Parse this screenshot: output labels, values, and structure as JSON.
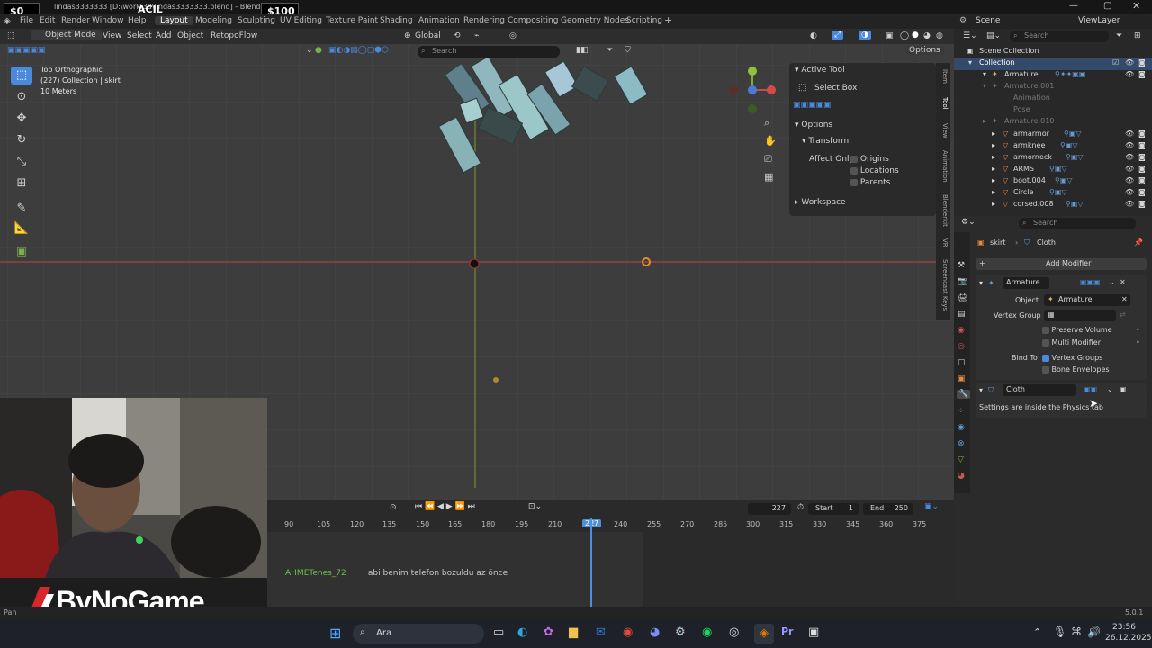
{
  "overlay": {
    "left_money": "$0",
    "tag": "ACIL",
    "right_money": "$100"
  },
  "window": {
    "title": "lindas3333333 [D:\\work\\3d\\lindas3333333.blend] - Blender 5.0.1"
  },
  "menu": [
    "File",
    "Edit",
    "Render",
    "Window",
    "Help"
  ],
  "workspaces": [
    "Layout",
    "Modeling",
    "Sculpting",
    "UV Editing",
    "Texture Paint",
    "Shading",
    "Animation",
    "Rendering",
    "Compositing",
    "Geometry Nodes",
    "Scripting"
  ],
  "scene": {
    "scene_label": "Scene",
    "viewlayer_label": "ViewLayer"
  },
  "viewport_header": {
    "mode": "Object Mode",
    "menus": [
      "View",
      "Select",
      "Add",
      "Object",
      "RetopoFlow"
    ],
    "transform": "Global",
    "options": "Options",
    "search_placeholder": "Search"
  },
  "viewport_info": {
    "view": "Top Orthographic",
    "collection": "(227) Collection | skirt",
    "scale": "10 Meters"
  },
  "npanel": {
    "active_tool_title": "Active Tool",
    "tool_name": "Select Box",
    "options_title": "Options",
    "transform_title": "Transform",
    "affect_only": "Affect Only",
    "origins": "Origins",
    "locations": "Locations",
    "parents": "Parents",
    "workspace": "Workspace"
  },
  "ntabs": [
    "Item",
    "Tool",
    "View",
    "Animation",
    "Blenderkit",
    "VR",
    "Screencast Keys"
  ],
  "timeline": {
    "current_frame": "227",
    "start_label": "Start",
    "start": "1",
    "end_label": "End",
    "end": "250",
    "ticks": [
      "90",
      "105",
      "120",
      "135",
      "150",
      "165",
      "180",
      "195",
      "210",
      "227",
      "240",
      "255",
      "270",
      "285",
      "300",
      "315",
      "330",
      "345",
      "360",
      "375"
    ]
  },
  "chat": {
    "user": "AHMETenes_72",
    "message": ": abi benim telefon bozuldu az önce"
  },
  "outliner": {
    "search_placeholder": "Search",
    "root": "Scene Collection",
    "collection": "Collection",
    "items": [
      "Armature",
      "Armature.001",
      "Animation",
      "Pose",
      "Armature.010",
      "armarmor",
      "armknee",
      "armorneck",
      "ARMS",
      "boot.004",
      "Circle",
      "corsed.008"
    ]
  },
  "properties": {
    "search_placeholder": "Search",
    "breadcrumb_object": "skirt",
    "breadcrumb_modifier": "Cloth",
    "add_modifier": "Add Modifier",
    "armature_mod_name": "Armature",
    "object_label": "Object",
    "object_value": "Armature",
    "vertex_group_label": "Vertex Group",
    "preserve_volume": "Preserve Volume",
    "multi_modifier": "Multi Modifier",
    "bind_to": "Bind To",
    "vertex_groups": "Vertex Groups",
    "bone_envelopes": "Bone Envelopes",
    "cloth_mod_name": "Cloth",
    "cloth_note": "Settings are inside the Physics tab"
  },
  "status": {
    "left": "Pan",
    "version": "5.0.1"
  },
  "brand": {
    "logo_text": "ByNoGame"
  },
  "taskbar": {
    "search_text": "Ara",
    "time": "23:56",
    "date": "26.12.2025"
  },
  "colors": {
    "accent": "#4a89dc",
    "x_axis": "#c84a4a",
    "y_axis": "#8fb335",
    "playhead": "#4f8fd9",
    "chat_user": "#6fbf4f"
  }
}
